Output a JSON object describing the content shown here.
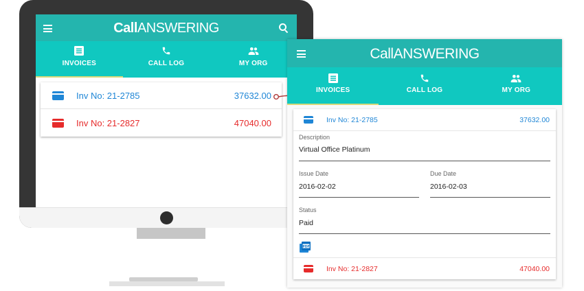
{
  "app": {
    "logo_call": "Call",
    "logo_answering": "ANSWERING"
  },
  "tabs": [
    {
      "label": "INVOICES",
      "icon": "invoice-icon",
      "active": true
    },
    {
      "label": "CALL LOG",
      "icon": "phone-icon",
      "active": false
    },
    {
      "label": "MY ORG",
      "icon": "group-icon",
      "active": false
    }
  ],
  "invoices": [
    {
      "number": "Inv No: 21-2785",
      "amount": "37632.00",
      "status_color": "#1f86d6",
      "icon": "credit-card-icon"
    },
    {
      "number": "Inv No: 21-2827",
      "amount": "47040.00",
      "status_color": "#e62b2b",
      "icon": "credit-card-icon"
    }
  ],
  "detail": {
    "description_label": "Description",
    "description_value": "Virtual Office Platinum",
    "issue_date_label": "Issue Date",
    "issue_date_value": "2016-02-02",
    "due_date_label": "Due Date",
    "due_date_value": "2016-02-03",
    "status_label": "Status",
    "status_value": "Paid",
    "pdf_icon": "pdf-icon"
  },
  "colors": {
    "toolbar": "#24b5ae",
    "tabs": "#10c8c0",
    "indicator": "#d8d97a",
    "paid_blue": "#1f86d6",
    "unpaid_red": "#e62b2b"
  }
}
